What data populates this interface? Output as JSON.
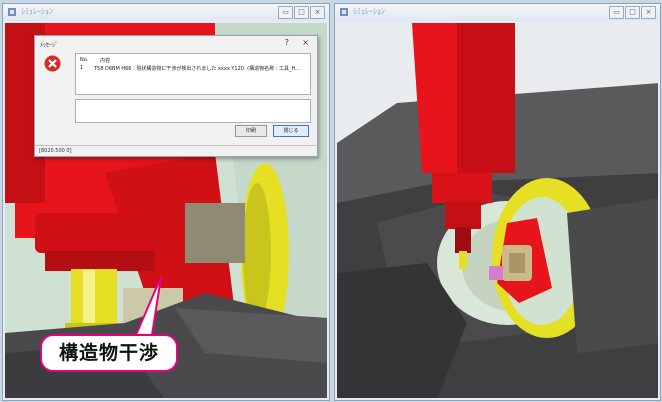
{
  "left_window": {
    "title": "ｼﾐｭﾚｰｼｮﾝ",
    "buttons": [
      "▭",
      "□",
      "×"
    ]
  },
  "right_window": {
    "title": "ｼﾐｭﾚｰｼｮﾝ",
    "buttons": [
      "▭",
      "□",
      "×"
    ]
  },
  "dialog": {
    "title": "ﾒｯｾｰｼﾞ",
    "help": "?",
    "close": "×",
    "columns": {
      "no": "No.",
      "content": "内容"
    },
    "row": {
      "no": "1",
      "content": "T58 D6BM H66 : 現状構造物に干渉が検出されました  xxxx Y120.  (構造物名称 : 工具_H..."
    },
    "detail": "",
    "button_print": "印刷",
    "button_close": "閉じる",
    "status": "[8020.500 0]"
  },
  "callout": {
    "text": "構造物干渉"
  },
  "colors": {
    "spindle_red": "#e8141c",
    "tool_yellow": "#e5e023",
    "accent_pink": "#e6007e",
    "fixture_gray": "#4a4a4c",
    "background_mint": "#cfe1d3"
  }
}
